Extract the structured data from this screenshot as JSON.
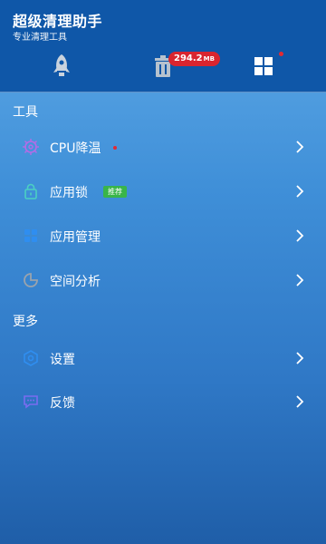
{
  "header": {
    "title": "超级清理助手",
    "subtitle": "专业清理工具",
    "badge_value": "294.2",
    "badge_unit": "MB"
  },
  "sections": {
    "tools": "工具",
    "more": "更多"
  },
  "items": [
    {
      "label": "CPU降温",
      "icon": "cpu-icon",
      "color": "#b56be6"
    },
    {
      "label": "应用锁",
      "icon": "lock-icon",
      "color": "#4bd0c2",
      "tag": "推荐"
    },
    {
      "label": "应用管理",
      "icon": "apps-icon",
      "color": "#2f8ef0"
    },
    {
      "label": "空间分析",
      "icon": "pie-chart-icon",
      "color": "#9aa3ad"
    },
    {
      "label": "设置",
      "icon": "gear-icon",
      "color": "#2f8ef0"
    },
    {
      "label": "反馈",
      "icon": "feedback-icon",
      "color": "#7a6cf0"
    }
  ],
  "colors": {
    "header_bg": "#0f57a8",
    "badge_red": "#d9252f",
    "tag_green": "#39b54a"
  }
}
